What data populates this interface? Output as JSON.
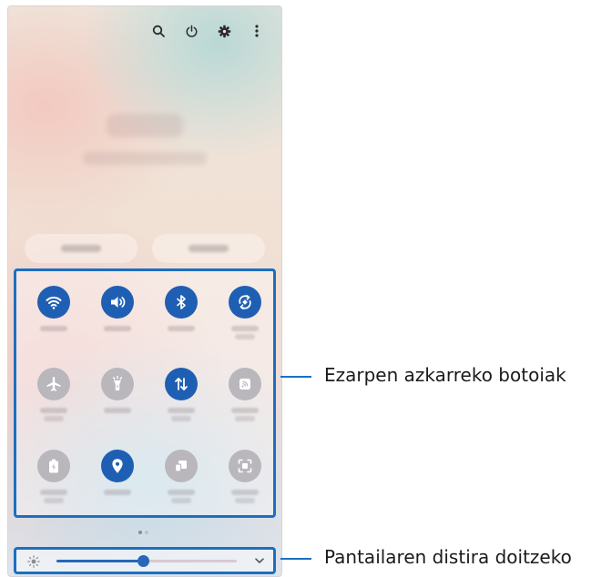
{
  "callouts": {
    "quick_settings": "Ezarpen azkarreko botoiak",
    "brightness": "Pantailaren distira doitzeko"
  },
  "top_icons": [
    "search-icon",
    "power-icon",
    "gear-icon",
    "more-vertical-icon"
  ],
  "tiles": [
    {
      "name": "wifi",
      "icon": "wifi-icon",
      "active": true
    },
    {
      "name": "sound",
      "icon": "sound-icon",
      "active": true
    },
    {
      "name": "bluetooth",
      "icon": "bluetooth-icon",
      "active": true
    },
    {
      "name": "auto-rotate",
      "icon": "auto-rotate-icon",
      "active": true
    },
    {
      "name": "airplane-mode",
      "icon": "airplane-icon",
      "active": false
    },
    {
      "name": "flashlight",
      "icon": "flashlight-icon",
      "active": false
    },
    {
      "name": "mobile-data",
      "icon": "mobile-data-icon",
      "active": true
    },
    {
      "name": "mobile-hotspot",
      "icon": "hotspot-icon",
      "active": false
    },
    {
      "name": "power-saving",
      "icon": "battery-icon",
      "active": false
    },
    {
      "name": "location",
      "icon": "location-icon",
      "active": true
    },
    {
      "name": "link-to-windows",
      "icon": "link-windows-icon",
      "active": false
    },
    {
      "name": "screen-recorder",
      "icon": "screen-record-icon",
      "active": false
    }
  ],
  "brightness": {
    "level": 0.48
  },
  "colors": {
    "accent": "#1f5fb3",
    "inactive": "#b9b7bc",
    "highlight_border": "#1c6fc0"
  }
}
